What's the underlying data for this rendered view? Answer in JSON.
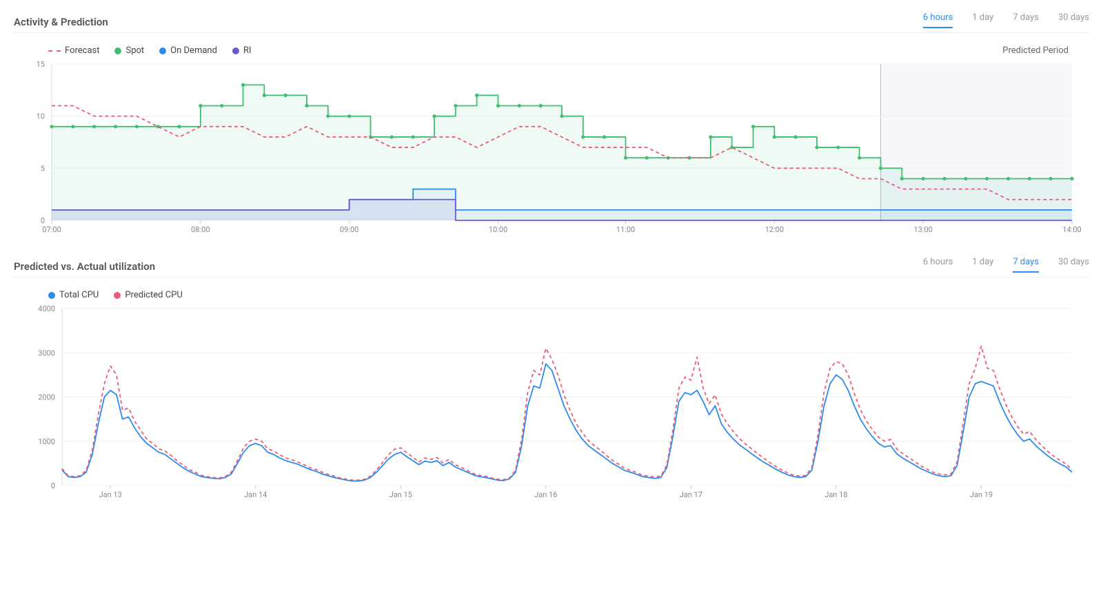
{
  "panels": {
    "activity": {
      "title": "Activity & Prediction",
      "predicted_label": "Predicted Period",
      "tabs": [
        "6 hours",
        "1 day",
        "7 days",
        "30 days"
      ],
      "active_tab": 0,
      "legend": {
        "forecast": "Forecast",
        "spot": "Spot",
        "on_demand": "On Demand",
        "ri": "RI"
      }
    },
    "utilization": {
      "title": "Predicted vs. Actual utilization",
      "tabs": [
        "6 hours",
        "1 day",
        "7 days",
        "30 days"
      ],
      "active_tab": 2,
      "legend": {
        "total": "Total CPU",
        "predicted": "Predicted CPU"
      }
    }
  },
  "colors": {
    "forecast": "#e85d7a",
    "spot": "#3fbf6f",
    "on_demand": "#2b8aef",
    "ri": "#6a5acd",
    "total": "#2b8aef",
    "predicted": "#e85d7a",
    "axis": "#888",
    "grid": "#eee",
    "tab_active": "#2b8aef"
  },
  "chart_data": [
    {
      "id": "activity",
      "type": "line",
      "title": "Activity & Prediction",
      "xlabel": "",
      "ylabel": "",
      "ylim": [
        0,
        15
      ],
      "yticks": [
        0,
        5,
        10,
        15
      ],
      "categories": [
        "07:00",
        "08:00",
        "09:00",
        "10:00",
        "11:00",
        "12:00",
        "13:00",
        "14:00"
      ],
      "x_subdivisions": 6,
      "predicted_start": "12:10",
      "series": [
        {
          "name": "Spot",
          "style": "step",
          "color": "#3fbf6f",
          "fill": "rgba(63,191,111,0.08)",
          "markers": true,
          "values": [
            9,
            9,
            9,
            9,
            9,
            9,
            9,
            11,
            11,
            13,
            12,
            12,
            11,
            10,
            10,
            8,
            8,
            8,
            10,
            11,
            12,
            11,
            11,
            11,
            10,
            8,
            8,
            6,
            6,
            6,
            6,
            8,
            7,
            9,
            8,
            8,
            7,
            7,
            6,
            5,
            4,
            4,
            4,
            4,
            4,
            4,
            4,
            4,
            4
          ]
        },
        {
          "name": "On Demand",
          "style": "step",
          "color": "#2b8aef",
          "fill": "rgba(43,138,239,0.07)",
          "markers": false,
          "values": [
            1,
            1,
            1,
            1,
            1,
            1,
            1,
            1,
            1,
            1,
            1,
            1,
            1,
            1,
            2,
            2,
            2,
            3,
            3,
            1,
            1,
            1,
            1,
            1,
            1,
            1,
            1,
            1,
            1,
            1,
            1,
            1,
            1,
            1,
            1,
            1,
            1,
            1,
            1,
            1,
            1,
            1,
            1,
            1,
            1,
            1,
            1,
            1,
            1
          ]
        },
        {
          "name": "RI",
          "style": "step",
          "color": "#6a5acd",
          "fill": "rgba(106,90,205,0.10)",
          "markers": false,
          "values": [
            1,
            1,
            1,
            1,
            1,
            1,
            1,
            1,
            1,
            1,
            1,
            1,
            1,
            1,
            2,
            2,
            2,
            2,
            2,
            0,
            0,
            0,
            0,
            0,
            0,
            0,
            0,
            0,
            0,
            0,
            0,
            0,
            0,
            0,
            0,
            0,
            0,
            0,
            0,
            0,
            0,
            0,
            0,
            0,
            0,
            0,
            0,
            0,
            0
          ]
        },
        {
          "name": "Forecast",
          "style": "dashed",
          "color": "#e85d7a",
          "markers": false,
          "values": [
            11,
            11,
            10,
            10,
            10,
            9,
            8,
            9,
            9,
            9,
            8,
            8,
            9,
            8,
            8,
            8,
            7,
            7,
            8,
            8,
            7,
            8,
            9,
            9,
            8,
            7,
            7,
            7,
            7,
            6,
            6,
            6,
            7,
            6,
            5,
            5,
            5,
            5,
            4,
            4,
            3,
            3,
            3,
            3,
            3,
            2,
            2,
            2,
            2
          ]
        }
      ]
    },
    {
      "id": "utilization",
      "type": "line",
      "title": "Predicted vs. Actual utilization",
      "xlabel": "",
      "ylabel": "",
      "ylim": [
        0,
        4000
      ],
      "yticks": [
        0,
        1000,
        2000,
        3000,
        4000
      ],
      "categories": [
        "Jan 13",
        "Jan 14",
        "Jan 15",
        "Jan 16",
        "Jan 17",
        "Jan 18",
        "Jan 19"
      ],
      "points_per_day": 24,
      "series": [
        {
          "name": "Total CPU",
          "style": "solid",
          "color": "#2b8aef",
          "values": [
            350,
            200,
            180,
            200,
            300,
            700,
            1400,
            2000,
            2150,
            2050,
            1500,
            1550,
            1300,
            1100,
            950,
            850,
            750,
            700,
            600,
            500,
            400,
            320,
            260,
            200,
            180,
            160,
            150,
            180,
            260,
            500,
            750,
            900,
            950,
            900,
            750,
            700,
            620,
            560,
            520,
            480,
            420,
            360,
            320,
            260,
            220,
            180,
            150,
            120,
            100,
            100,
            120,
            180,
            300,
            450,
            600,
            700,
            750,
            650,
            560,
            470,
            550,
            520,
            560,
            450,
            520,
            420,
            360,
            300,
            240,
            200,
            180,
            150,
            120,
            110,
            150,
            300,
            900,
            1800,
            2250,
            2200,
            2750,
            2600,
            2200,
            1800,
            1500,
            1250,
            1050,
            900,
            800,
            700,
            600,
            500,
            420,
            340,
            300,
            250,
            200,
            180,
            160,
            180,
            400,
            1100,
            1900,
            2100,
            2050,
            2150,
            1900,
            1600,
            1800,
            1400,
            1200,
            1050,
            920,
            820,
            720,
            620,
            530,
            450,
            370,
            300,
            240,
            200,
            180,
            200,
            350,
            1000,
            1800,
            2300,
            2500,
            2400,
            2150,
            1800,
            1500,
            1280,
            1100,
            950,
            870,
            900,
            720,
            620,
            540,
            460,
            380,
            320,
            260,
            220,
            200,
            220,
            450,
            1200,
            2000,
            2300,
            2350,
            2300,
            2250,
            1900,
            1600,
            1350,
            1150,
            1000,
            1050,
            900,
            780,
            670,
            570,
            490,
            420,
            300
          ]
        },
        {
          "name": "Predicted CPU",
          "style": "dashed",
          "color": "#e85d7a",
          "values": [
            380,
            220,
            200,
            220,
            340,
            800,
            1600,
            2300,
            2700,
            2500,
            1700,
            1750,
            1450,
            1250,
            1050,
            950,
            830,
            780,
            680,
            560,
            460,
            360,
            300,
            230,
            200,
            180,
            170,
            200,
            300,
            560,
            850,
            1000,
            1050,
            1000,
            830,
            780,
            690,
            620,
            580,
            530,
            470,
            400,
            360,
            300,
            250,
            210,
            170,
            140,
            120,
            120,
            140,
            210,
            350,
            520,
            700,
            820,
            850,
            740,
            640,
            530,
            620,
            590,
            630,
            510,
            590,
            470,
            410,
            340,
            270,
            230,
            210,
            170,
            140,
            130,
            170,
            350,
            1050,
            2100,
            2600,
            2500,
            3100,
            2850,
            2500,
            2050,
            1700,
            1400,
            1200,
            1020,
            900,
            800,
            680,
            570,
            480,
            390,
            340,
            290,
            230,
            210,
            190,
            210,
            460,
            1250,
            2200,
            2450,
            2380,
            2900,
            2200,
            1850,
            2050,
            1620,
            1400,
            1220,
            1060,
            940,
            830,
            720,
            620,
            520,
            430,
            350,
            280,
            230,
            210,
            230,
            410,
            1150,
            2100,
            2650,
            2800,
            2750,
            2500,
            2080,
            1720,
            1460,
            1260,
            1090,
            1000,
            1040,
            830,
            720,
            630,
            540,
            440,
            370,
            300,
            260,
            240,
            260,
            530,
            1400,
            2300,
            2650,
            3150,
            2650,
            2600,
            2200,
            1850,
            1560,
            1330,
            1160,
            1220,
            1040,
            900,
            770,
            660,
            570,
            490,
            350
          ]
        }
      ]
    }
  ]
}
